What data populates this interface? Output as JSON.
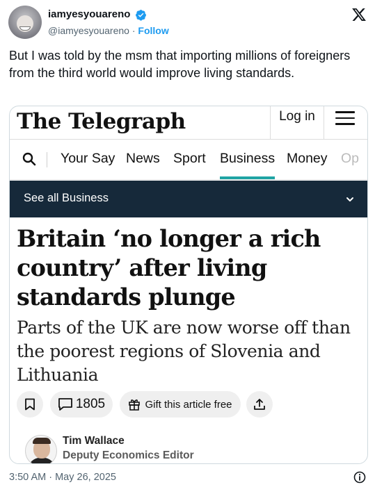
{
  "tweet": {
    "display_name": "iamyesyouareno",
    "handle": "@iamyesyouareno",
    "separator": " · ",
    "follow_label": "Follow",
    "text": "But I was told by the msm that importing millions of foreigners from the third world would improve living standards.",
    "timestamp": "3:50 AM · May 26, 2025",
    "verified_color": "#1d9bf0"
  },
  "embed": {
    "logo_text": "The Telegraph",
    "login_label": "Log in",
    "nav_items": [
      "Your Say",
      "News",
      "Sport",
      "Business",
      "Money",
      "Op"
    ],
    "active_nav": "Business",
    "see_all_label": "See all Business",
    "headline": "Britain ‘no longer a rich country’ after living standards plunge",
    "standfirst": "Parts of the UK are now worse off than the poorest regions of Slovenia and Lithuania",
    "comment_count": "1805",
    "gift_label": "Gift this article free",
    "author_name": "Tim Wallace",
    "author_role": "Deputy Economics Editor",
    "nav_bar_color": "#16293a",
    "accent_color": "#1fa4a4"
  },
  "icons": [
    "x-logo-icon",
    "verified-badge-icon",
    "menu-icon",
    "search-icon",
    "chevron-down-icon",
    "bookmark-icon",
    "comment-icon",
    "gift-icon",
    "share-icon",
    "info-icon"
  ]
}
